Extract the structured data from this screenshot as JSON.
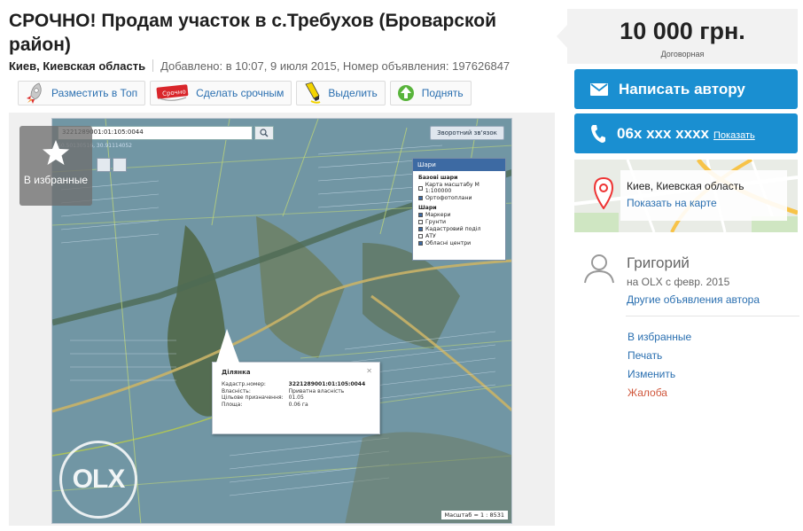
{
  "listing": {
    "title": "СРОЧНО! Продам участок в с.Требухов (Броварской район)",
    "location": "Киев, Киевская область",
    "added": "Добавлено: в 10:07, 9 июля 2015, Номер объявления: 197626847"
  },
  "actions": [
    {
      "label": "Разместить в Топ",
      "icon": "rocket-icon"
    },
    {
      "label": "Сделать срочным",
      "icon": "urgent-badge-icon",
      "badge": "Срочно"
    },
    {
      "label": "Выделить",
      "icon": "highlighter-icon"
    },
    {
      "label": "Поднять",
      "icon": "up-arrow-icon"
    }
  ],
  "photo": {
    "favorite_label": "В избранные",
    "watermark": "OLX",
    "map": {
      "search_value": "3221289001:01:105:0044",
      "coords_text": "50.50130516, 30.91114052",
      "feedback_label": "Зворотний зв'язок",
      "layers_title": "Шари",
      "base_layers_title": "Базові шари",
      "base_layers": [
        {
          "label": "Карта масштабу М 1:100000",
          "checked": false
        },
        {
          "label": "Ортофотоплани",
          "checked": true
        }
      ],
      "layers_section": "Шари",
      "layers": [
        {
          "label": "Маркери",
          "checked": true
        },
        {
          "label": "Грунти",
          "checked": false
        },
        {
          "label": "Кадастровий поділ",
          "checked": true
        },
        {
          "label": "АТУ",
          "checked": false
        },
        {
          "label": "Обласні центри",
          "checked": true
        }
      ],
      "popup": {
        "title": "Ділянка",
        "rows": [
          {
            "k": "Кадастр.номер:",
            "v": "3221289001:01:105:0044"
          },
          {
            "k": "Власність:",
            "v": "Приватна власність"
          },
          {
            "k": "Цільове призначення:",
            "v": "01.05"
          },
          {
            "k": "Площа:",
            "v": "0.06 га"
          }
        ]
      },
      "scale": "Масштаб = 1 : 8531"
    }
  },
  "sidebar": {
    "price": "10 000 грн.",
    "price_note": "Договорная",
    "write_author": "Написать автору",
    "phone": "06х ххх хххх",
    "phone_show": "Показать",
    "map_location": "Киев, Киевская область",
    "map_show": "Показать на карте",
    "author_name": "Григорий",
    "author_since": "на OLX с февр. 2015",
    "author_other": "Другие объявления автора",
    "links": [
      "В избранные",
      "Печать",
      "Изменить",
      "Жалоба"
    ]
  },
  "colors": {
    "accent_blue": "#1a8fd1",
    "link_blue": "#2a6fb0",
    "complaint": "#d0573c"
  }
}
